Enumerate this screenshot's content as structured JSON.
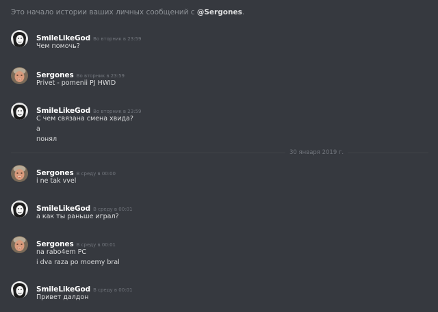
{
  "intro": {
    "prefix": "Это начало истории ваших личных сообщений с ",
    "username": "@Sergones",
    "suffix": "."
  },
  "date_divider": "30 января 2019 г.",
  "messages": [
    {
      "author": "SmileLikeGod",
      "timestamp": "Во вторник в 23:59",
      "avatar": "smilelikegod-avatar",
      "lines": [
        "Чем помочь?"
      ]
    },
    {
      "author": "Sergones",
      "timestamp": "Во вторник в 23:59",
      "avatar": "sergones-avatar",
      "lines": [
        "Privet - pomenii PJ HWID"
      ]
    },
    {
      "author": "SmileLikeGod",
      "timestamp": "Во вторник в 23:59",
      "avatar": "smilelikegod-avatar",
      "lines": [
        "С чем связана смена хвида?",
        "а",
        "понял"
      ]
    },
    {
      "author": "Sergones",
      "timestamp": "В среду в 00:00",
      "avatar": "sergones-avatar",
      "lines": [
        "i ne tak vvel"
      ]
    },
    {
      "author": "SmileLikeGod",
      "timestamp": "В среду в 00:01",
      "avatar": "smilelikegod-avatar",
      "lines": [
        "а как ты раньше играл?"
      ]
    },
    {
      "author": "Sergones",
      "timestamp": "В среду в 00:01",
      "avatar": "sergones-avatar",
      "lines": [
        "na rabo4em PC",
        "i dva raza po moemy bral"
      ]
    },
    {
      "author": "SmileLikeGod",
      "timestamp": "В среду в 00:01",
      "avatar": "smilelikegod-avatar",
      "lines": [
        "Привет далдон"
      ]
    }
  ],
  "colors": {
    "background": "#36393f",
    "author": "#ffffff",
    "text": "#dcddde",
    "timestamp": "#72767d",
    "intro": "#8e9297"
  }
}
